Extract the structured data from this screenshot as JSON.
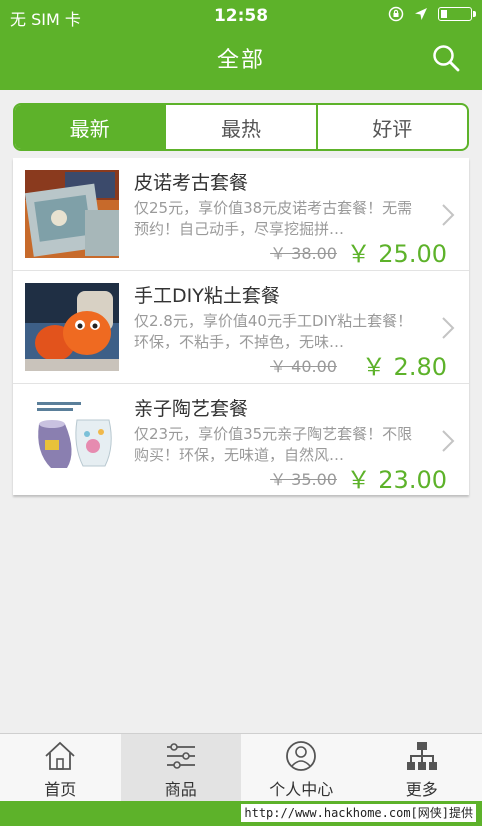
{
  "status_bar": {
    "carrier": "无 SIM 卡",
    "time": "12:58"
  },
  "header": {
    "title": "全部"
  },
  "tabs": [
    {
      "label": "最新",
      "active": true
    },
    {
      "label": "最热",
      "active": false
    },
    {
      "label": "好评",
      "active": false
    }
  ],
  "products": [
    {
      "title": "皮诺考古套餐",
      "desc": "仅25元，享价值38元皮诺考古套餐！无需预约！自己动手，尽享挖掘拼…",
      "original_price": "￥ 38.00",
      "price": "￥ 25.00"
    },
    {
      "title": "手工DIY粘土套餐",
      "desc": "仅2.8元，享价值40元手工DIY粘土套餐！环保，不粘手，不掉色，无味…",
      "original_price": "￥ 40.00",
      "price": "￥ 2.80"
    },
    {
      "title": "亲子陶艺套餐",
      "desc": "仅23元，享价值35元亲子陶艺套餐！不限购买！环保，无味道，自然风…",
      "original_price": "￥ 35.00",
      "price": "￥ 23.00"
    }
  ],
  "tabbar": [
    {
      "label": "首页",
      "icon": "home-icon",
      "active": false
    },
    {
      "label": "商品",
      "icon": "list-icon",
      "active": true
    },
    {
      "label": "个人中心",
      "icon": "user-icon",
      "active": false
    },
    {
      "label": "更多",
      "icon": "sitemap-icon",
      "active": false
    }
  ],
  "watermark": "http://www.hackhome.com[网侠]提供",
  "colors": {
    "accent": "#5db22a",
    "price": "#5db22a"
  }
}
